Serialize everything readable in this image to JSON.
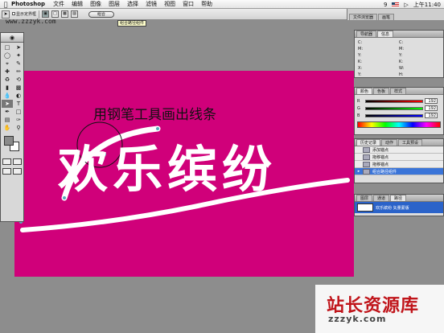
{
  "menubar": {
    "app_name": "Photoshop",
    "items": [
      "文件",
      "编辑",
      "图像",
      "图层",
      "选择",
      "滤镜",
      "视图",
      "窗口",
      "帮助"
    ],
    "keyboard_indicator": "9",
    "clock": "上午11:40"
  },
  "options_bar": {
    "checkbox_label": "显示定界框",
    "mode_pill": "组合",
    "tooltip": "组合路径组件"
  },
  "browser_tabs": [
    "文件浏览器",
    "画笔"
  ],
  "site_watermark_top": "www.zzzyk.com",
  "canvas": {
    "annotation": "用钢笔工具画出线条",
    "headline": "欢乐缤纷",
    "background_color": "#d0007a"
  },
  "info_panel": {
    "tabs": [
      "导航器",
      "信息"
    ],
    "labels": [
      "C:",
      "M:",
      "Y:",
      "K:",
      "X:",
      "Y:"
    ],
    "labels_right": [
      "C:",
      "M:",
      "Y:",
      "K:",
      "W:",
      "H:"
    ]
  },
  "color_panel": {
    "tabs": [
      "颜色",
      "色板",
      "样式"
    ],
    "channels": [
      {
        "name": "R",
        "value": "192"
      },
      {
        "name": "G",
        "value": "192"
      },
      {
        "name": "B",
        "value": "192"
      }
    ]
  },
  "history_panel": {
    "tabs": [
      "历史记录",
      "动作",
      "工具预设"
    ],
    "items": [
      "添加锚点",
      "拖移锚点",
      "拖移锚点",
      "组合路径组件"
    ],
    "selected_index": 3
  },
  "paths_panel": {
    "tabs": [
      "图层",
      "通道",
      "路径"
    ],
    "item": "欢乐缤纷 矢量蒙版"
  },
  "bottom_watermark": {
    "title": "站长资源库",
    "url": "zzzyk.com"
  }
}
